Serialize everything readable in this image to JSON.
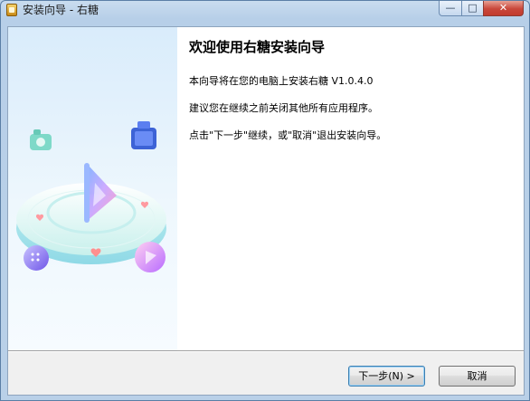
{
  "window": {
    "title": "安装向导 - 右糖",
    "minimize_label": "—",
    "maximize_label": "□",
    "close_label": "✕",
    "icon": "installer-icon",
    "close_color": "#c9473a"
  },
  "main": {
    "heading": "欢迎使用右糖安装向导",
    "paragraphs": [
      "本向导将在您的电脑上安装右糖 V1.0.4.0",
      "建议您在继续之前关闭其他所有应用程序。",
      "点击\"下一步\"继续，或\"取消\"退出安装向导。"
    ]
  },
  "buttons": {
    "next_label": "下一步(N) >",
    "cancel_label": "取消"
  }
}
